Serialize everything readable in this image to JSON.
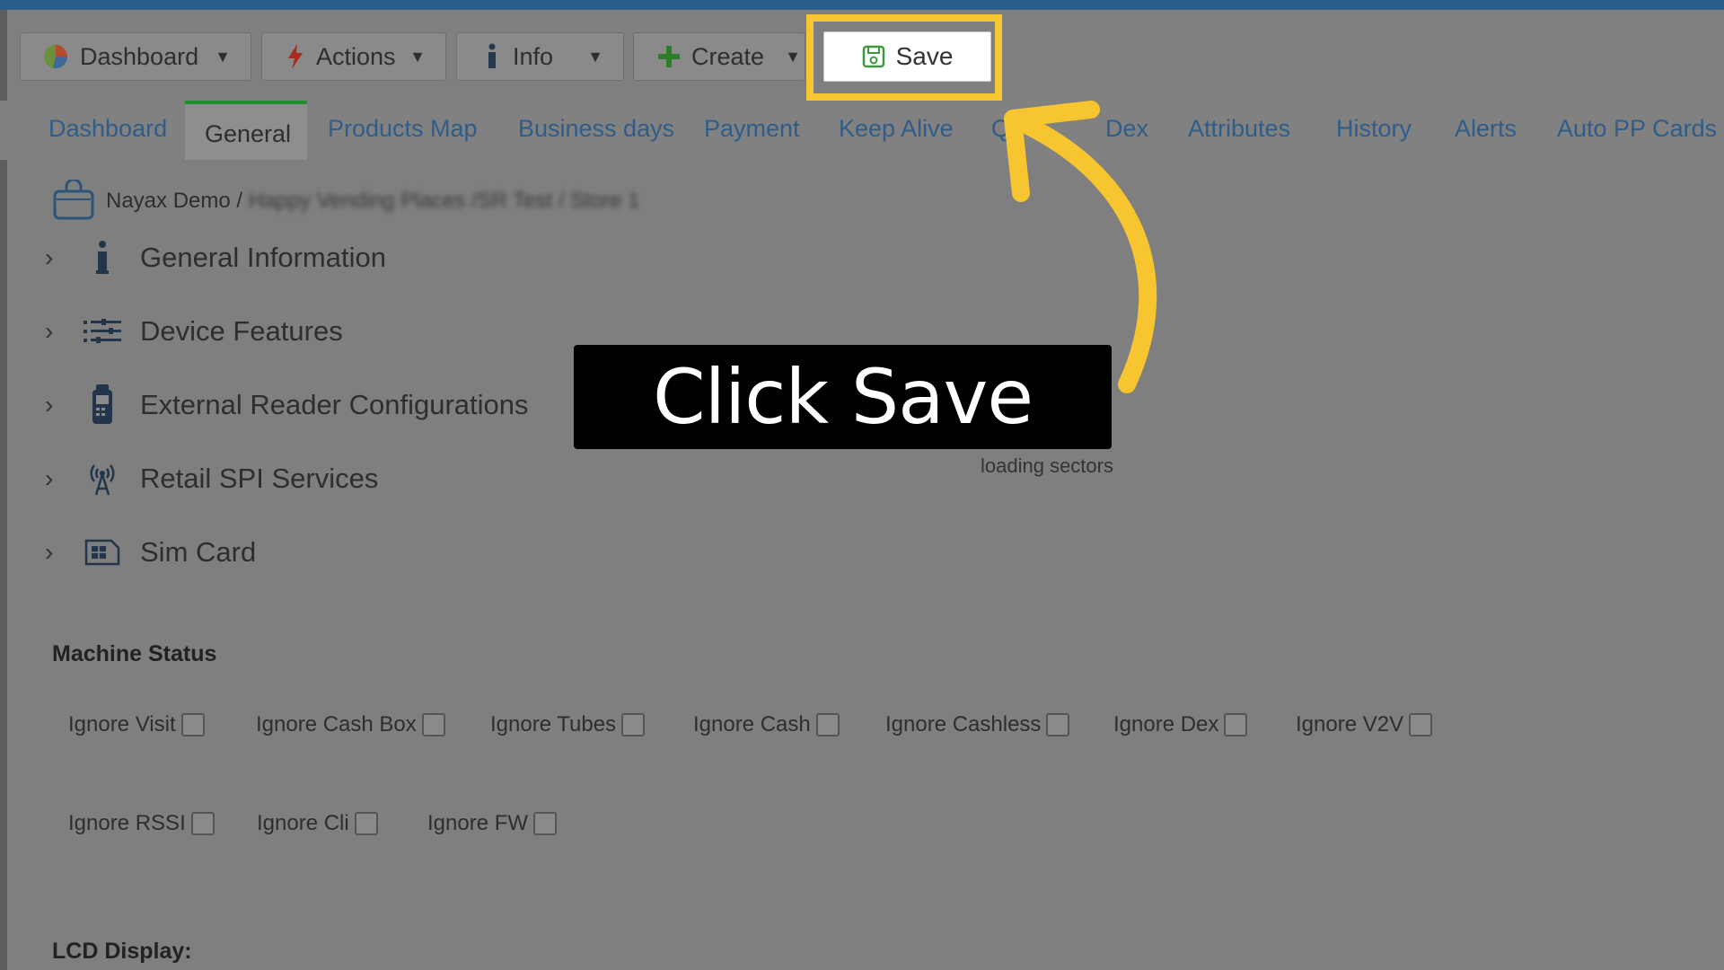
{
  "toolbar": {
    "dashboard": "Dashboard",
    "actions": "Actions",
    "info": "Info",
    "create": "Create",
    "save": "Save"
  },
  "tabs": [
    "Dashboard",
    "General",
    "Products Map",
    "Business days",
    "Payment",
    "Keep Alive",
    "Q",
    "Dex",
    "Attributes",
    "History",
    "Alerts",
    "Auto PP Cards"
  ],
  "breadcrumb": {
    "root": "Nayax Demo /",
    "rest": "Happy Vending Places /SR Test /  Store 1"
  },
  "sections": [
    "General Information",
    "Device Features",
    "External Reader Configurations",
    "Retail SPI Services",
    "Sim Card"
  ],
  "loading_text": "loading sectors",
  "machine_status": {
    "title": "Machine Status",
    "row1": [
      "Ignore Visit",
      "Ignore Cash Box",
      "Ignore Tubes",
      "Ignore Cash",
      "Ignore Cashless",
      "Ignore Dex",
      "Ignore V2V"
    ],
    "row2": [
      "Ignore RSSI",
      "Ignore Cli",
      "Ignore FW"
    ]
  },
  "lcd_display_title": "LCD Display:",
  "callout": "Click Save",
  "colors": {
    "highlight": "#f7c530",
    "topbar": "#2b5d8a",
    "active_tab_border": "#1f8f2f",
    "tab_link": "#2f5c88"
  }
}
